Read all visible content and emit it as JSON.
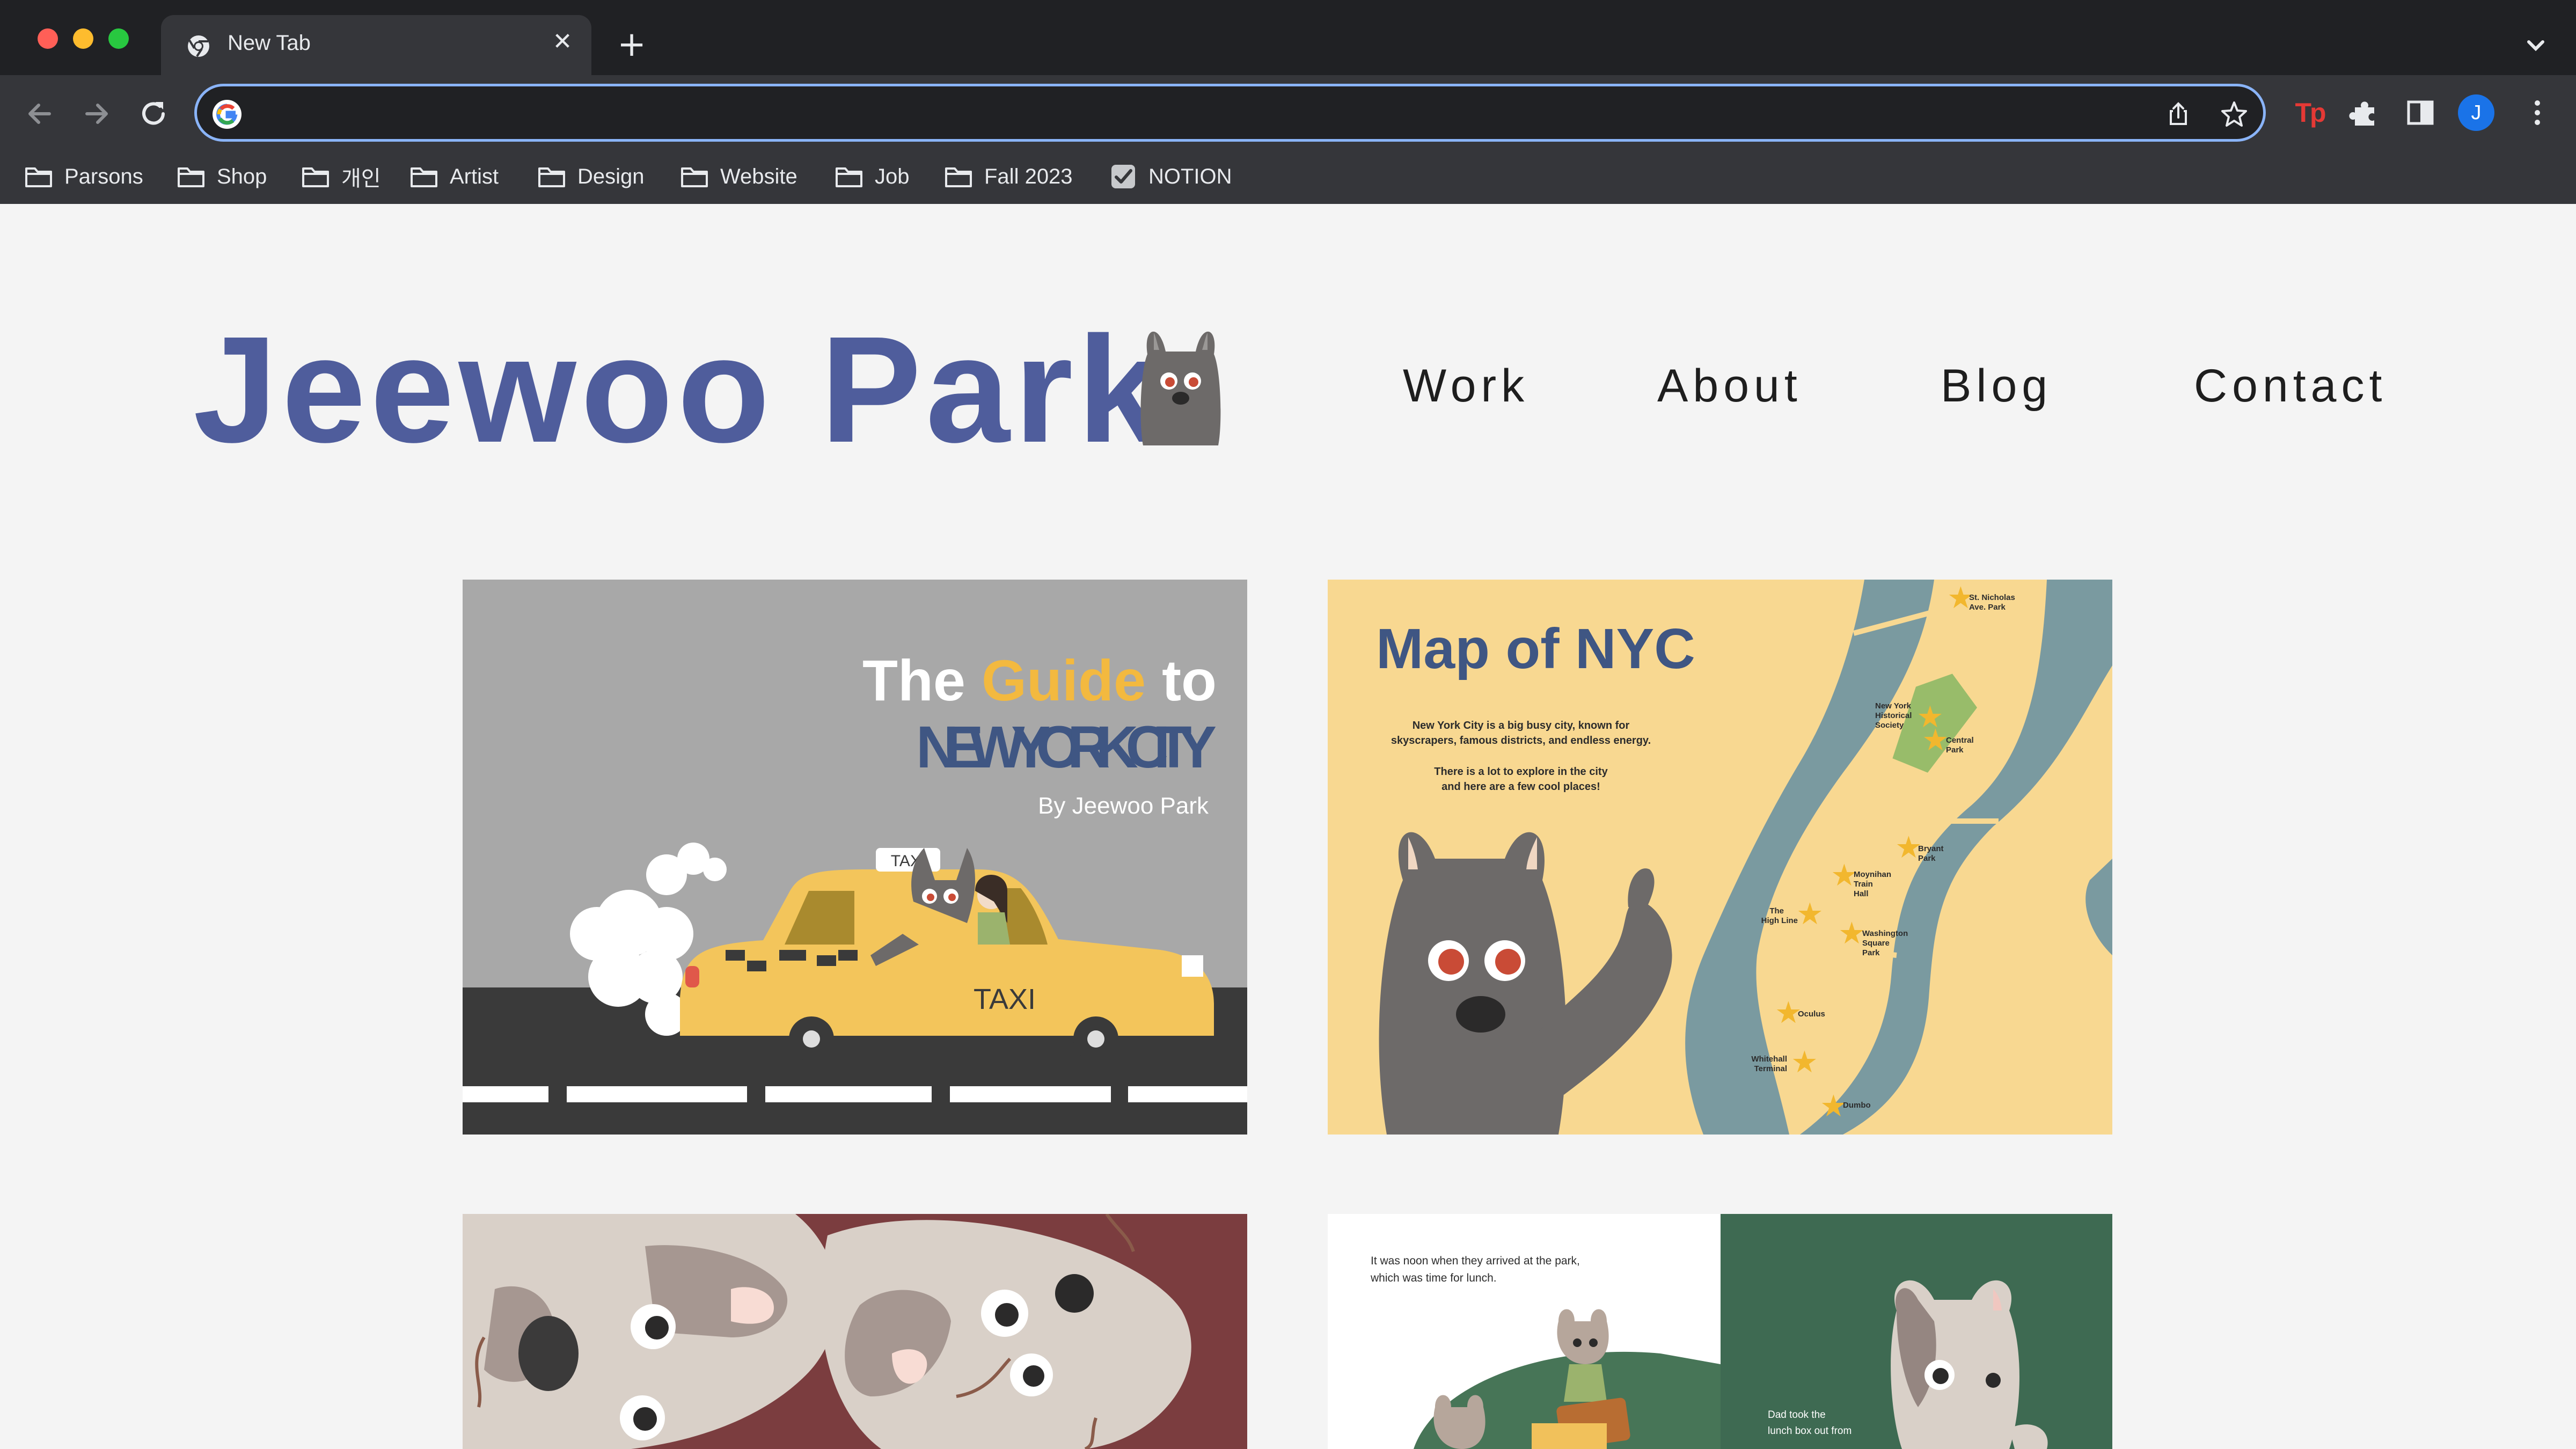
{
  "browser": {
    "tab_title": "New Tab",
    "address_placeholder": "",
    "profile_initial": "J",
    "extension_label": "Tp",
    "bookmarks": [
      "Parsons",
      "Shop",
      "개인",
      "Artist",
      "Design",
      "Website",
      "Job",
      "Fall 2023",
      "NOTION"
    ],
    "colors": {
      "chrome": "#35363a",
      "tabstrip": "#202124",
      "focus_ring": "#8ab4f8",
      "profile": "#1a73e8"
    }
  },
  "site": {
    "logo": "Jeewoo Park",
    "nav": [
      "Work",
      "About",
      "Blog",
      "Contact"
    ],
    "colors": {
      "logo": "#4f5d9c",
      "background": "#f4f4f4"
    }
  },
  "works": {
    "guide": {
      "title_the": "The",
      "title_guide": "Guide",
      "title_to": "to",
      "title_city": "NEW YORK CITY",
      "byline": "By Jeewoo Park",
      "taxi_sign": "TAXI",
      "taxi_door": "TAXI"
    },
    "map": {
      "title": "Map of NYC",
      "intro_1": "New York City is a big busy city, known for",
      "intro_2": "skyscrapers, famous districts, and endless energy.",
      "intro_3": "There is a lot to explore in the city",
      "intro_4": "and here are a few cool places!",
      "places": [
        [
          "St. Nicholas",
          "Ave. Park"
        ],
        [
          "New York",
          "Historical",
          "Society"
        ],
        [
          "Central",
          "Park"
        ],
        [
          "Bryant",
          "Park"
        ],
        [
          "Moynihan",
          "Train",
          "Hall"
        ],
        [
          "The",
          "High Line"
        ],
        [
          "Washington",
          "Square",
          "Park"
        ],
        [
          "Oculus"
        ],
        [
          "Whitehall",
          "Terminal"
        ],
        [
          "Dumbo"
        ]
      ]
    },
    "story": {
      "line_1": "It was noon when they arrived at the park,",
      "line_2": "which was time for lunch.",
      "line_3": "Dad took the",
      "line_4": "lunch box out from"
    }
  }
}
